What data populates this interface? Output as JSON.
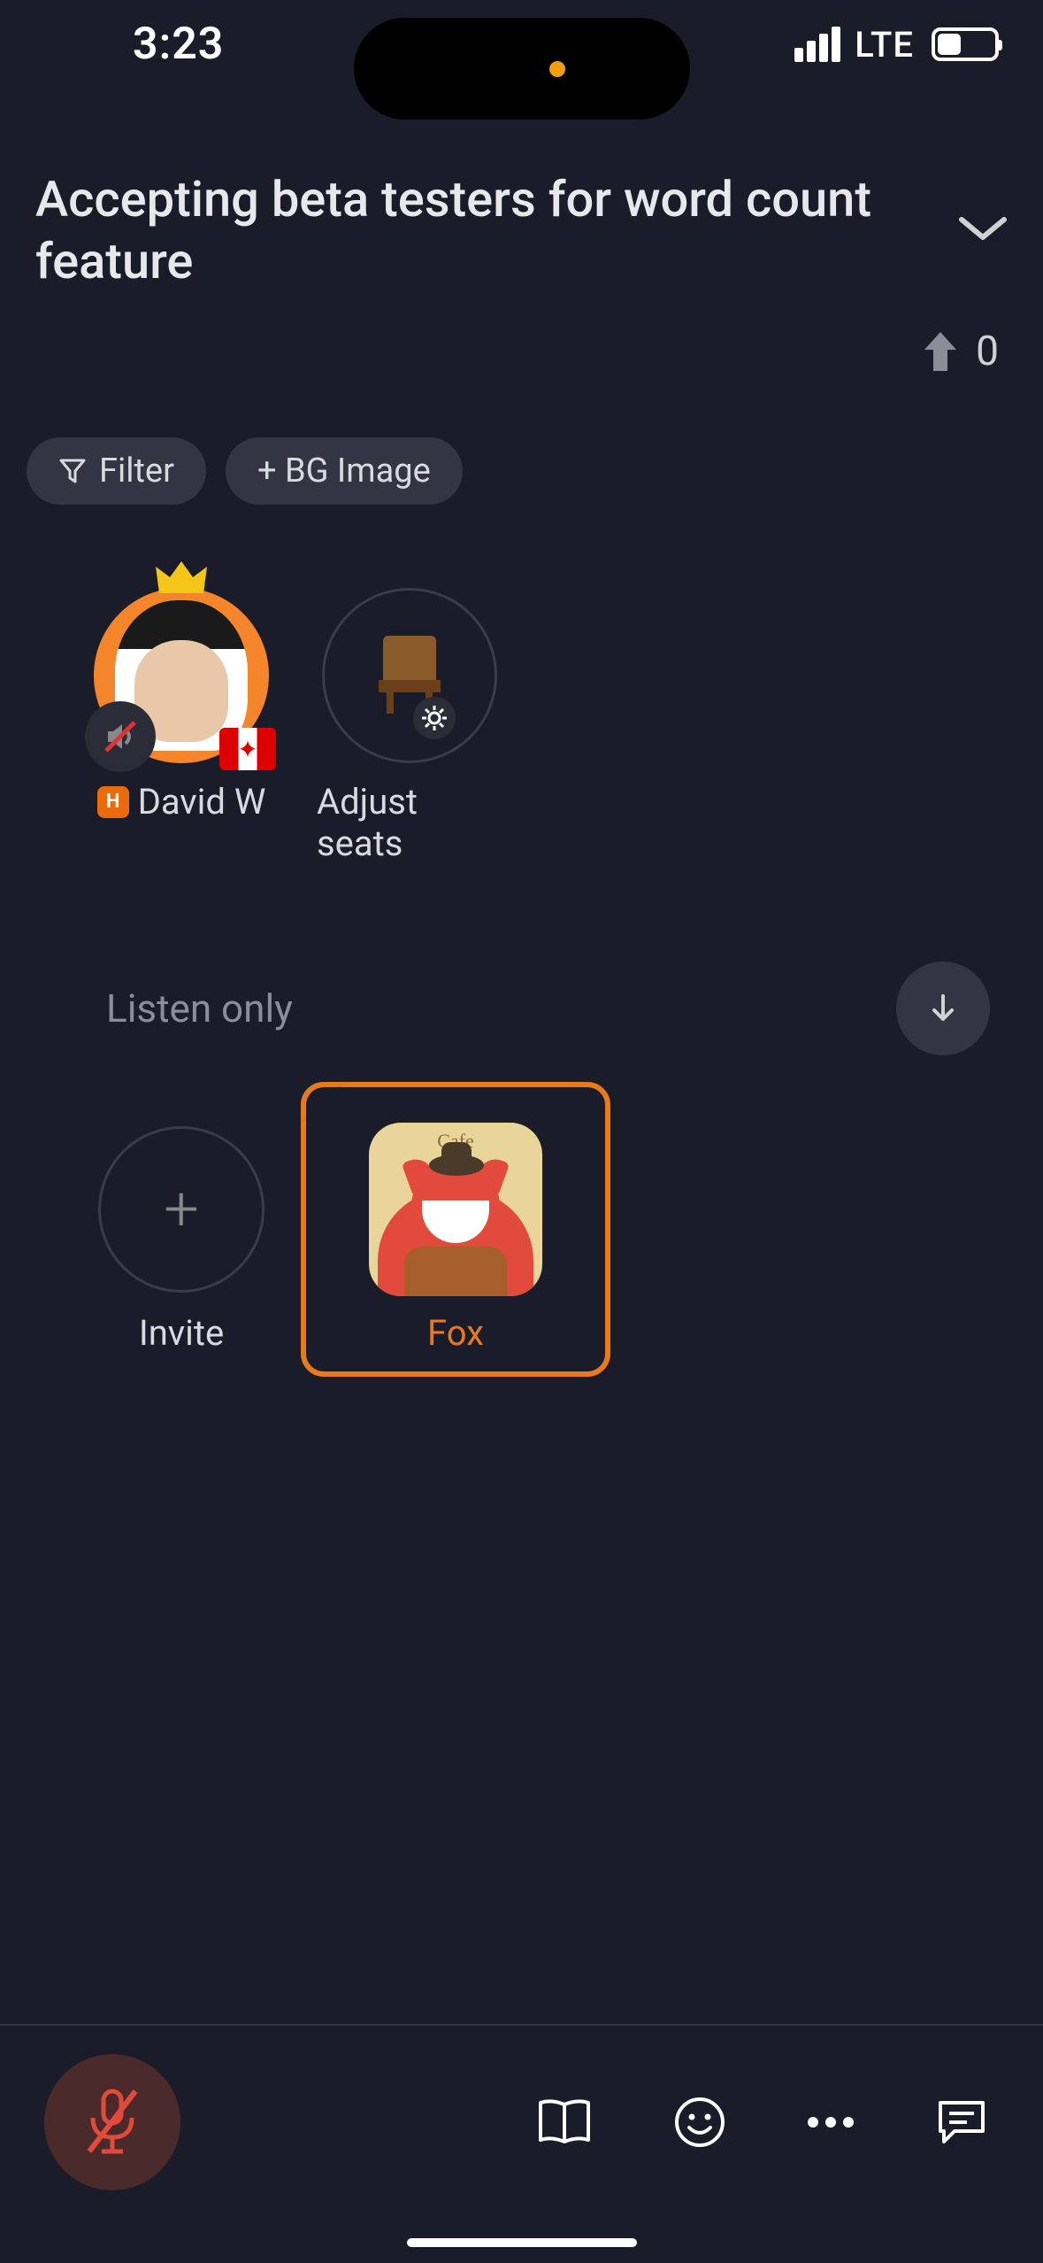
{
  "status": {
    "time": "3:23",
    "network": "LTE"
  },
  "header": {
    "title": "Accepting beta testers for word count feature",
    "upvotes": "0"
  },
  "controls": {
    "filter_label": "Filter",
    "bg_image_label": "+ BG Image"
  },
  "seats": {
    "host_name": "David W",
    "host_badge": "H",
    "adjust_label": "Adjust seats"
  },
  "listen": {
    "section_label": "Listen only",
    "invite_label": "Invite",
    "fox_label": "Fox",
    "fox_caption": "Cafe"
  }
}
